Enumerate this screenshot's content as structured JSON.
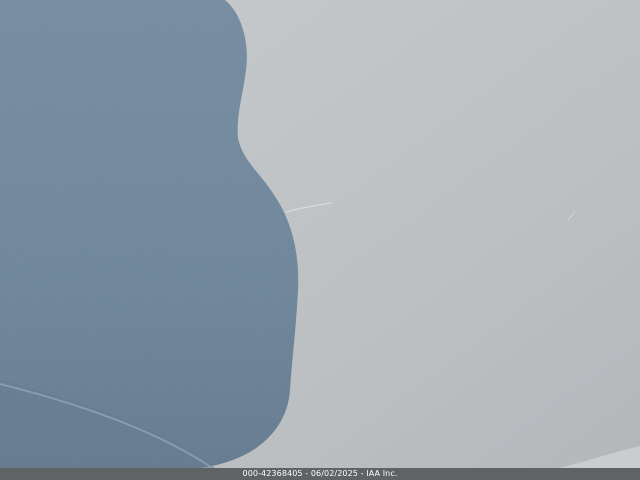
{
  "photo": {
    "subject": "close-up of silver vehicle body panel with a person's shadow and faint scratch",
    "colors": {
      "panel_light": "#c7cacc",
      "panel_mid": "#b4b8bb",
      "shadow": "#6f889e",
      "shadow_dark": "#5c7489",
      "footer_bg": "#5f6366",
      "footer_text": "#ffffff"
    }
  },
  "footer": {
    "caption": "000-42368405 - 06/02/2025 - IAA Inc."
  }
}
